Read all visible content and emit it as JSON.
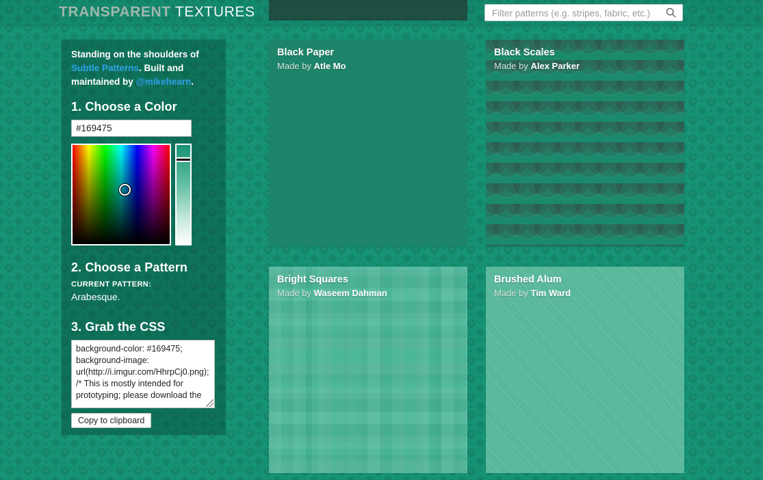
{
  "header": {
    "title_primary": "TRANSPARENT",
    "title_secondary": "TEXTURES",
    "ad_slot_name": "ad-banner",
    "search": {
      "placeholder": "Filter patterns (e.g. stripes, fabric, etc.)",
      "value": "",
      "icon": "search-icon"
    }
  },
  "sidebar": {
    "blurb": {
      "line_start": "Standing on the shoulders of ",
      "link_subtle_patterns": "Subtle Patterns",
      "line_middle": ". Built and maintained by ",
      "link_author": "@mikehearn",
      "line_end": "."
    },
    "step1": {
      "heading": "1. Choose a Color",
      "color_value": "#169475",
      "color_placeholder": "#169475"
    },
    "step2": {
      "heading": "2. Choose a Pattern",
      "current_pattern_label": "CURRENT PATTERN:",
      "current_pattern_value": "Arabesque."
    },
    "step3": {
      "heading": "3. Grab the CSS",
      "css_text": "background-color: #169475;\nbackground-image: url(http://i.imgur.com/HhrpCj0.png);\n/* This is mostly intended for prototyping; please download the",
      "copy_button": "Copy to clipboard"
    }
  },
  "patterns": [
    {
      "name": "Black Paper",
      "made_by_prefix": "Made by ",
      "author": "Atle Mo",
      "color": "#1d8a6e"
    },
    {
      "name": "Black Scales",
      "made_by_prefix": "Made by ",
      "author": "Alex Parker",
      "color": "#1b8a6c"
    },
    {
      "name": "Bright Squares",
      "made_by_prefix": "Made by ",
      "author": "Waseem Dahman",
      "color": "#46b495"
    },
    {
      "name": "Brushed Alum",
      "made_by_prefix": "Made by ",
      "author": "Tim Ward",
      "color": "#57b89b"
    }
  ],
  "theme": {
    "background_color": "#169475",
    "link_color": "#2ea1e8",
    "title_primary_color": "#9fb7ad",
    "title_secondary_color": "#f2f7f5"
  }
}
